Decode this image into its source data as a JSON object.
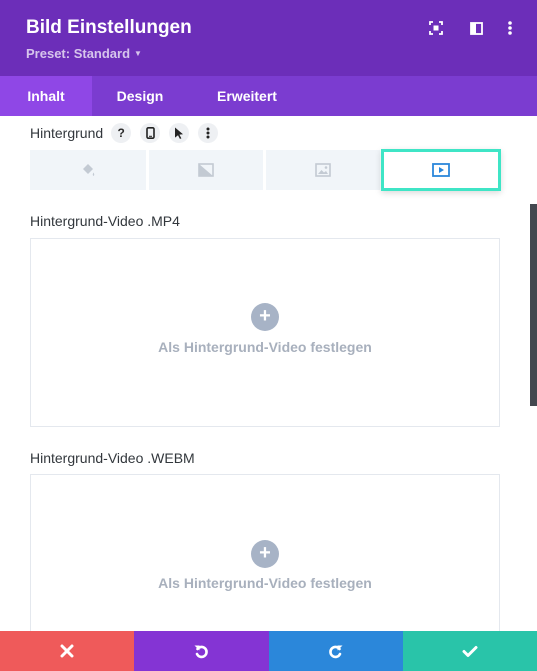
{
  "header": {
    "title": "Bild Einstellungen",
    "preset": "Preset: Standard",
    "icons": [
      "expand-icon",
      "sidebar-layout-icon",
      "more-vertical-icon"
    ]
  },
  "tabs": [
    {
      "label": "Inhalt",
      "active": true
    },
    {
      "label": "Design",
      "active": false
    },
    {
      "label": "Erweitert",
      "active": false
    }
  ],
  "background": {
    "label": "Hintergrund",
    "help_symbol": "?",
    "tool_icons": [
      "help-icon",
      "mobile-icon",
      "cursor-icon",
      "more-vertical-icon"
    ],
    "type_tabs": [
      {
        "icon": "paint-bucket-icon",
        "selected": false
      },
      {
        "icon": "gradient-icon",
        "selected": false
      },
      {
        "icon": "image-icon",
        "selected": false
      },
      {
        "icon": "video-icon",
        "selected": true
      }
    ]
  },
  "fields": [
    {
      "label": "Hintergrund-Video .MP4",
      "button": "Als Hintergrund-Video festlegen"
    },
    {
      "label": "Hintergrund-Video .WEBM",
      "button": "Als Hintergrund-Video festlegen"
    }
  ],
  "footer": {
    "buttons": [
      {
        "icon": "close-icon",
        "color": "#ef5a5a"
      },
      {
        "icon": "undo-icon",
        "color": "#8434d4"
      },
      {
        "icon": "redo-icon",
        "color": "#2b87da"
      },
      {
        "icon": "check-icon",
        "color": "#29c4a9"
      }
    ]
  },
  "colors": {
    "header": "#6c2eb9",
    "tabs": "#7b3cd0",
    "active_tab": "#8f47e6",
    "selected_outline": "#3fe5c6",
    "video_icon": "#2b87da"
  }
}
